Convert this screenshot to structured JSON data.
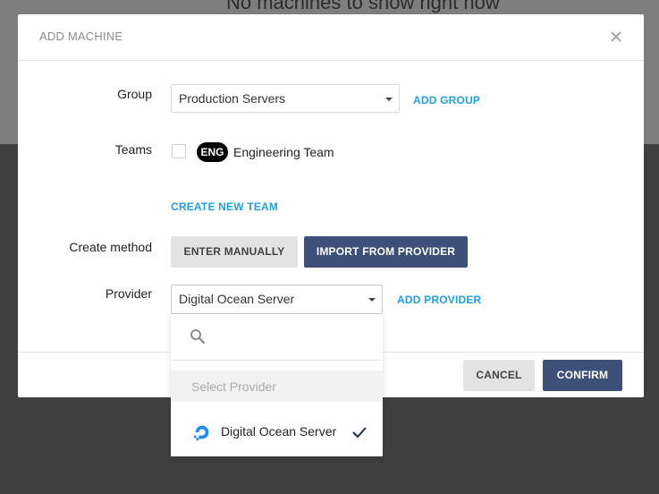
{
  "background": {
    "title": "No machines to show right now"
  },
  "modal": {
    "title": "ADD MACHINE"
  },
  "form": {
    "group": {
      "label": "Group",
      "value": "Production Servers",
      "add_link": "ADD GROUP"
    },
    "teams": {
      "label": "Teams",
      "badge": "ENG",
      "team_name": "Engineering Team",
      "create_link": "CREATE NEW TEAM"
    },
    "create_method": {
      "label": "Create method",
      "manual": "ENTER MANUALLY",
      "import": "IMPORT FROM PROVIDER"
    },
    "provider": {
      "label": "Provider",
      "value": "Digital Ocean Server",
      "add_link": "ADD PROVIDER"
    }
  },
  "dropdown": {
    "search_placeholder": "",
    "placeholder_option": "Select Provider",
    "options": [
      {
        "label": "Digital Ocean Server",
        "selected": true
      }
    ]
  },
  "footer": {
    "cancel": "CANCEL",
    "confirm": "CONFIRM"
  },
  "colors": {
    "accent": "#1ea0e6",
    "primary_button": "#3c5079",
    "secondary_button": "#e3e3e3"
  },
  "icons": {
    "close": "close-icon",
    "search": "search-icon",
    "check": "check-icon",
    "provider": "digitalocean-logo"
  }
}
